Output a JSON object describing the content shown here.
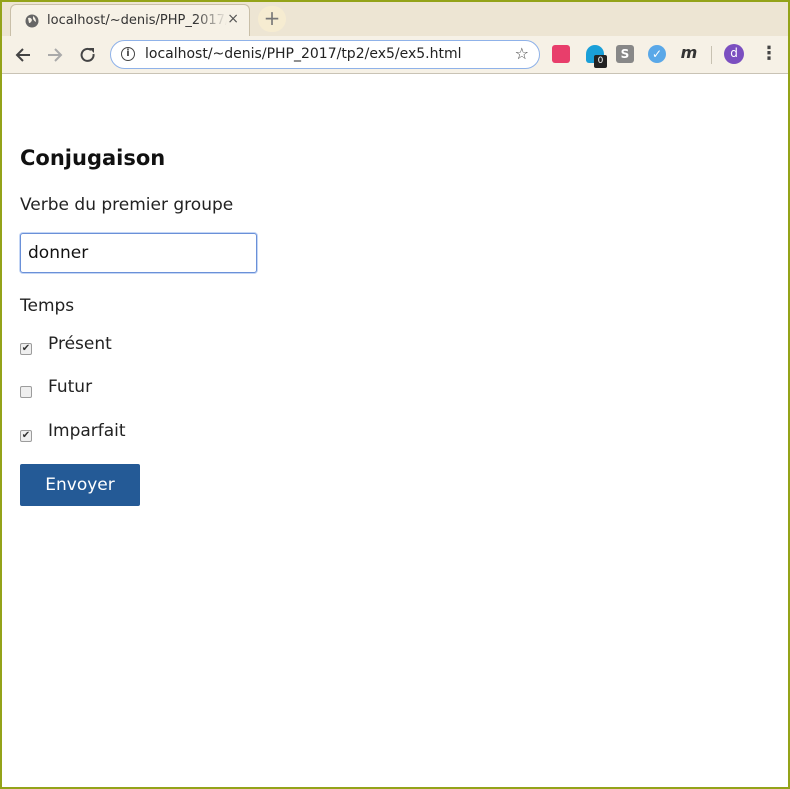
{
  "browser": {
    "tab_title": "localhost/~denis/PHP_2017/tp2/ex5/ex5.html",
    "tab_close": "×",
    "new_tab": "+",
    "url": "localhost/~denis/PHP_2017/tp2/ex5/ex5.html",
    "extension_badge": "0",
    "profile_initial": "d"
  },
  "form": {
    "heading": "Conjugaison",
    "verb_label": "Verbe du premier groupe",
    "verb_value": "donner",
    "tense_label": "Temps",
    "options": [
      {
        "label": "Présent",
        "checked": true
      },
      {
        "label": "Futur",
        "checked": false
      },
      {
        "label": "Imparfait",
        "checked": true
      }
    ],
    "submit_label": "Envoyer"
  },
  "icons": {
    "back": "back-arrow-icon",
    "forward": "forward-arrow-icon",
    "reload": "reload-icon",
    "info": "info-icon",
    "bookmark": "star-icon",
    "menu": "menu-dots-icon"
  },
  "colors": {
    "frame": "#94a319",
    "submit_bg": "#245a96",
    "input_focus": "#6a90d8"
  }
}
